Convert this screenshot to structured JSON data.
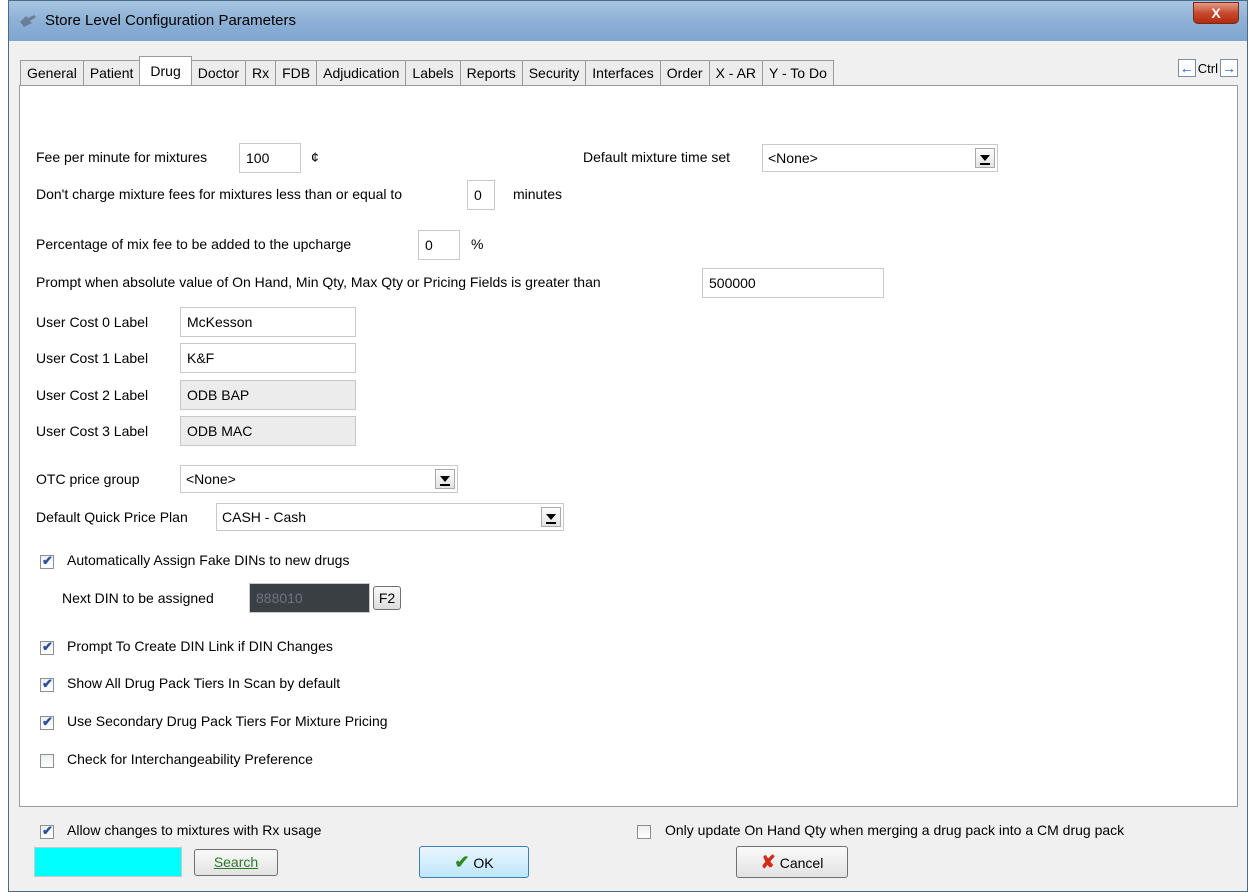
{
  "window": {
    "title": "Store Level Configuration Parameters",
    "close_label": "X"
  },
  "tabs": [
    {
      "label": "General",
      "active": false
    },
    {
      "label": "Patient",
      "active": false
    },
    {
      "label": "Drug",
      "active": true
    },
    {
      "label": "Doctor",
      "active": false
    },
    {
      "label": "Rx",
      "active": false
    },
    {
      "label": "FDB",
      "active": false
    },
    {
      "label": "Adjudication",
      "active": false
    },
    {
      "label": "Labels",
      "active": false
    },
    {
      "label": "Reports",
      "active": false
    },
    {
      "label": "Security",
      "active": false
    },
    {
      "label": "Interfaces",
      "active": false
    },
    {
      "label": "Order",
      "active": false
    },
    {
      "label": "X - AR",
      "active": false
    },
    {
      "label": "Y - To Do",
      "active": false
    }
  ],
  "tab_nav": {
    "left_arrow": "←",
    "ctrl_label": "Ctrl",
    "right_arrow": "→"
  },
  "drug": {
    "fee_per_minute_label": "Fee per minute for mixtures",
    "fee_per_minute_value": "100",
    "fee_unit": "¢",
    "default_mixture_time_label": "Default mixture time set",
    "default_mixture_time_value": "<None>",
    "dont_charge_label": "Don't charge mixture fees for mixtures less than or equal to",
    "dont_charge_value": "0",
    "dont_charge_unit": "minutes",
    "pct_mix_fee_label": "Percentage of mix fee to be added to the upcharge",
    "pct_mix_fee_value": "0",
    "pct_unit": "%",
    "prompt_abs_label": "Prompt when absolute value of On Hand, Min Qty, Max Qty or Pricing Fields is greater than",
    "prompt_abs_value": "500000",
    "user_cost_0_label": "User Cost 0 Label",
    "user_cost_0_value": "McKesson",
    "user_cost_1_label": "User Cost 1 Label",
    "user_cost_1_value": "K&F",
    "user_cost_2_label": "User Cost 2 Label",
    "user_cost_2_value": "ODB BAP",
    "user_cost_3_label": "User Cost 3 Label",
    "user_cost_3_value": "ODB MAC",
    "otc_price_group_label": "OTC price group",
    "otc_price_group_value": "<None>",
    "default_quick_price_label": "Default Quick Price Plan",
    "default_quick_price_value": "CASH - Cash",
    "auto_assign_fake_din_label": "Automatically Assign Fake DINs to new drugs",
    "auto_assign_fake_din_checked": true,
    "next_din_label": "Next DIN to be assigned",
    "next_din_value": "888010",
    "f2_label": "F2",
    "prompt_din_link_label": "Prompt To Create DIN Link if DIN Changes",
    "prompt_din_link_checked": true,
    "show_all_tiers_label": "Show All Drug Pack Tiers In Scan by default",
    "show_all_tiers_checked": true,
    "use_secondary_tiers_label": "Use Secondary Drug Pack Tiers For Mixture Pricing",
    "use_secondary_tiers_checked": true,
    "check_interchange_label": "Check for Interchangeability Preference",
    "check_interchange_checked": false,
    "allow_changes_mixtures_label": "Allow changes to mixtures with Rx usage",
    "allow_changes_mixtures_checked": true,
    "only_update_on_hand_label": "Only update On Hand Qty when merging a drug pack into a CM drug pack",
    "only_update_on_hand_checked": false
  },
  "footer": {
    "search_value": "",
    "search_label": "Search",
    "ok_label": "OK",
    "cancel_label": "Cancel"
  },
  "colors": {
    "search_field": "#00ffff",
    "ok_check": "#2e8b1f",
    "cancel_x": "#d42a1a"
  }
}
